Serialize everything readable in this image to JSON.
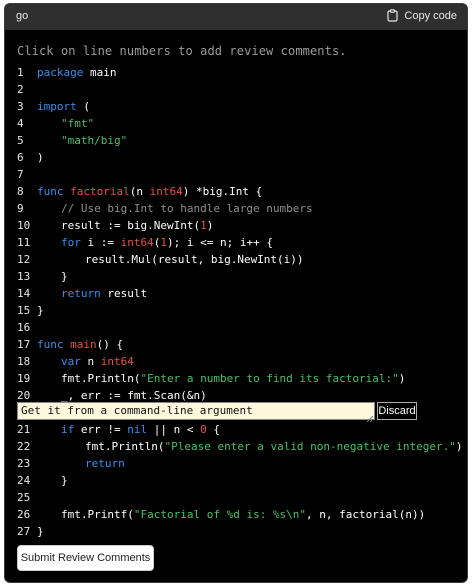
{
  "header": {
    "language": "go",
    "copy_label": "Copy code"
  },
  "hint": "Click on line numbers to add review comments.",
  "lines": [
    {
      "num": "1"
    },
    {
      "num": "2"
    },
    {
      "num": "3"
    },
    {
      "num": "4"
    },
    {
      "num": "5"
    },
    {
      "num": "6"
    },
    {
      "num": "7"
    },
    {
      "num": "8"
    },
    {
      "num": "9"
    },
    {
      "num": "10"
    },
    {
      "num": "11"
    },
    {
      "num": "12"
    },
    {
      "num": "13"
    },
    {
      "num": "14"
    },
    {
      "num": "15"
    },
    {
      "num": "16"
    },
    {
      "num": "17"
    },
    {
      "num": "18"
    },
    {
      "num": "19"
    },
    {
      "num": "20"
    },
    {
      "num": "21"
    },
    {
      "num": "22"
    },
    {
      "num": "23"
    },
    {
      "num": "24"
    },
    {
      "num": "25"
    },
    {
      "num": "26"
    },
    {
      "num": "27"
    }
  ],
  "code": {
    "l1": [
      "package",
      " main"
    ],
    "l3": [
      "import",
      " ("
    ],
    "l4": "\"fmt\"",
    "l5": "\"math/big\"",
    "l6": ")",
    "l8": [
      "func",
      " ",
      "factorial",
      "(n ",
      "int64",
      ") *big.Int {"
    ],
    "l9": "// Use big.Int to handle large numbers",
    "l10": [
      "result := big.NewInt(",
      "1",
      ")"
    ],
    "l11": [
      "for",
      " i := ",
      "int64",
      "(",
      "1",
      "); i <= n; i++ {"
    ],
    "l12": "result.Mul(result, big.NewInt(i))",
    "l13": "}",
    "l14": [
      "return",
      " result"
    ],
    "l15": "}",
    "l17": [
      "func",
      " ",
      "main",
      "() {"
    ],
    "l18": [
      "var",
      " n ",
      "int64"
    ],
    "l19": [
      "fmt.Println(",
      "\"Enter a number to find its factorial:\"",
      ")"
    ],
    "l20": "_, err := fmt.Scan(&n)",
    "l21": [
      "if",
      " err != ",
      "nil",
      " || n < ",
      "0",
      " {"
    ],
    "l22": [
      "fmt.Println(",
      "\"Please enter a valid non-negative integer.\"",
      ")"
    ],
    "l23": "return",
    "l24": "}",
    "l26": [
      "fmt.Printf(",
      "\"Factorial of %d is: %s\\n\"",
      ", n, factorial(n))"
    ],
    "l27": "}"
  },
  "review": {
    "comment_value": "Get it from a command-line argument",
    "discard_label": "Discard"
  },
  "submit_label": "Submit Review Comments",
  "colors": {
    "keyword": "#3b8eea",
    "function": "#e0544b",
    "string": "#4fbf68",
    "comment": "#8f8f8f",
    "background": "#000000"
  }
}
